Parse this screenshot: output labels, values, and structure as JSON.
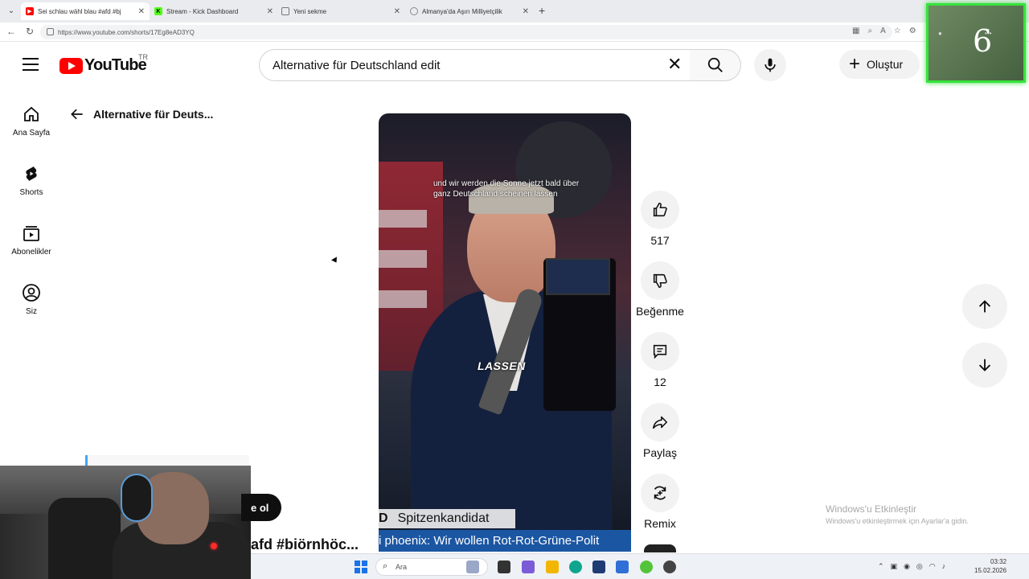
{
  "browser": {
    "tabs": [
      {
        "title": "Sei schlau wähl blau #afd #bj",
        "favicon_color": "#ff0000",
        "favicon": "youtube-icon",
        "active": true
      },
      {
        "title": "Stream - Kick Dashboard",
        "favicon_color": "#53fc18",
        "favicon": "kick-icon",
        "active": false
      },
      {
        "title": "Yeni sekme",
        "favicon_color": "#777777",
        "favicon": "page-icon",
        "active": false
      },
      {
        "title": "Almanya'da Aşırı Milliyetçilik",
        "favicon_color": "#888888",
        "favicon": "chatgpt-icon",
        "active": false
      }
    ],
    "url": "https://www.youtube.com/shorts/17Eg8eAD3YQ"
  },
  "header": {
    "logo_text": "YouTube",
    "country_code": "TR",
    "search_value": "Alternative für Deutschland edit",
    "create_label": "Oluştur"
  },
  "sidebar": {
    "items": [
      {
        "label": "Ana Sayfa",
        "icon": "home-icon"
      },
      {
        "label": "Shorts",
        "icon": "shorts-icon"
      },
      {
        "label": "Abonelikler",
        "icon": "subscriptions-icon"
      },
      {
        "label": "Siz",
        "icon": "you-icon"
      }
    ]
  },
  "back": {
    "title": "Alternative für Deuts..."
  },
  "video": {
    "caption_line1": "und wir werden die Sonne jetzt bald über",
    "caption_line2": "ganz Deutschland scheinen lassen",
    "burned_text": "LASSEN",
    "lower_third_party": "D",
    "lower_third_role": "Spitzenkandidat",
    "ticker": "i phoenix: Wir wollen Rot-Rot-Grüne-Polit"
  },
  "actions": {
    "like_count": "517",
    "dislike_label": "Beğenme",
    "comment_count": "12",
    "share_label": "Paylaş",
    "remix_label": "Remix"
  },
  "overlay": {
    "badge_number": "6"
  },
  "bottom": {
    "subscribe_partial": "e ol",
    "title_partial": "afd #biörnhöc..."
  },
  "watermark": {
    "line1": "Windows'u Etkinleştir",
    "line2": "Windows'u etkinleştirmek için Ayarlar'a gidin."
  },
  "taskbar": {
    "search_placeholder": "Ara",
    "time": "03:32",
    "date": "15.02.2026"
  }
}
